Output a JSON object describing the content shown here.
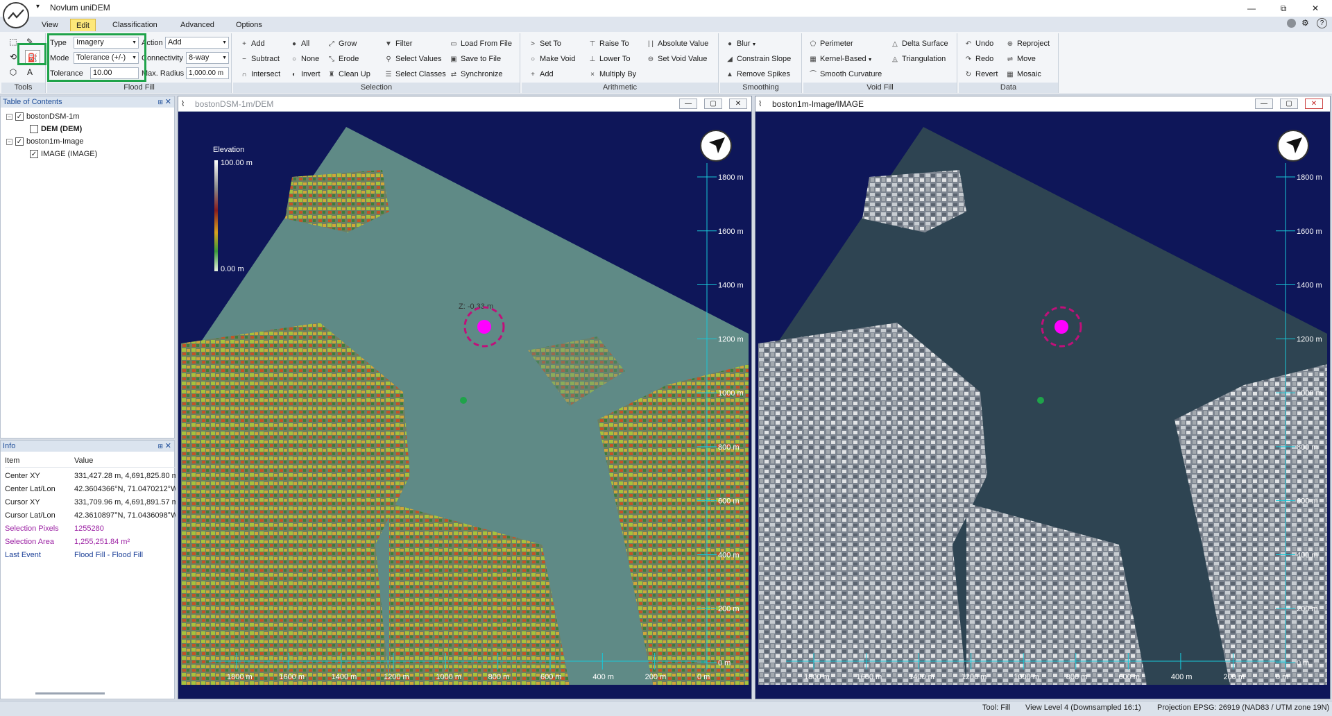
{
  "app": {
    "title": "Novlum uniDEM",
    "qat": "▾"
  },
  "window_buttons": {
    "minimize": "—",
    "restore": "⧉",
    "close": "✕"
  },
  "menu": {
    "tabs": [
      "View",
      "Edit",
      "Classification",
      "Advanced",
      "Options"
    ],
    "active": "Edit"
  },
  "ribbon": {
    "fill": {
      "type_label": "Type",
      "type_value": "Imagery",
      "mode_label": "Mode",
      "mode_value": "Tolerance (+/-)",
      "tolerance_label": "Tolerance",
      "tolerance_value": "10.00",
      "action_label": "Action",
      "action_value": "Add",
      "connectivity_label": "Connectivity",
      "connectivity_value": "8-way",
      "radius_label": "Max. Radius",
      "radius_value": "1,000.00 m"
    },
    "groups": {
      "tools": "Tools",
      "flood_fill": "Flood Fill",
      "selection": "Selection",
      "arithmetic": "Arithmetic",
      "smoothing": "Smoothing",
      "void_fill": "Void Fill",
      "data": "Data"
    },
    "selection": [
      "Add",
      "Subtract",
      "Intersect",
      "All",
      "None",
      "Invert",
      "Grow",
      "Erode",
      "Clean Up",
      "Filter",
      "Select Values",
      "Select Classes",
      "Load From File",
      "Save to File",
      "Synchronize"
    ],
    "arithmetic": [
      "Set To",
      "Make Void",
      "Add",
      "Raise To",
      "Lower To",
      "Multiply By",
      "Absolute Value",
      "Set Void Value"
    ],
    "smoothing": [
      "Blur",
      "Constrain Slope",
      "Remove Spikes"
    ],
    "void_fill": [
      "Perimeter",
      "Kernel-Based",
      "Smooth Curvature",
      "Delta Surface",
      "Triangulation"
    ],
    "data": [
      "Undo",
      "Redo",
      "Revert",
      "Reproject",
      "Move",
      "Mosaic"
    ]
  },
  "toc": {
    "title": "Table of Contents",
    "items": [
      {
        "label": "bostonDSM-1m",
        "checked": true
      },
      {
        "label": "DEM (DEM)",
        "checked": false
      },
      {
        "label": "boston1m-Image",
        "checked": true
      },
      {
        "label": "IMAGE (IMAGE)",
        "checked": true
      }
    ]
  },
  "info": {
    "title": "Info",
    "col_item": "Item",
    "col_value": "Value",
    "rows": [
      {
        "k": "Center XY",
        "v": "331,427.28 m, 4,691,825.80 m"
      },
      {
        "k": "Center Lat/Lon",
        "v": "42.3604366°N, 71.0470212°W"
      },
      {
        "k": "Cursor XY",
        "v": "331,709.96 m, 4,691,891.57 m"
      },
      {
        "k": "Cursor Lat/Lon",
        "v": "42.3610897°N, 71.0436098°W"
      },
      {
        "k": "Selection Pixels",
        "v": "1255280"
      },
      {
        "k": "Selection Area",
        "v": "1,255,251.84 m²"
      },
      {
        "k": "Last Event",
        "v": "Flood Fill - Flood Fill"
      }
    ]
  },
  "views": {
    "dem": {
      "title": "bostonDSM-1m/DEM"
    },
    "image": {
      "title": "boston1m-Image/IMAGE"
    }
  },
  "legend": {
    "title": "Elevation",
    "max": "100.00 m",
    "min": "0.00 m"
  },
  "cursor_label": "Z: -0.33 m",
  "y_ticks": [
    "1800 m",
    "1600 m",
    "1400 m",
    "1200 m",
    "1000 m",
    "800 m",
    "600 m",
    "400 m",
    "200 m",
    "0 m"
  ],
  "x_ticks": [
    "1800 m",
    "1600 m",
    "1400 m",
    "1200 m",
    "1000 m",
    "800 m",
    "600 m",
    "400 m",
    "200 m",
    "0 m"
  ],
  "colors": {
    "water": "#0e1659",
    "selection": "#5f8a86",
    "cyan": "#18c8d8",
    "magenta": "#ff00ff",
    "highlight": "#1fa34a"
  },
  "status": {
    "tool": "Tool: Fill",
    "view_level": "View Level 4 (Downsampled 16:1)",
    "projection": "Projection EPSG: 26919 (NAD83 / UTM zone 19N)"
  }
}
